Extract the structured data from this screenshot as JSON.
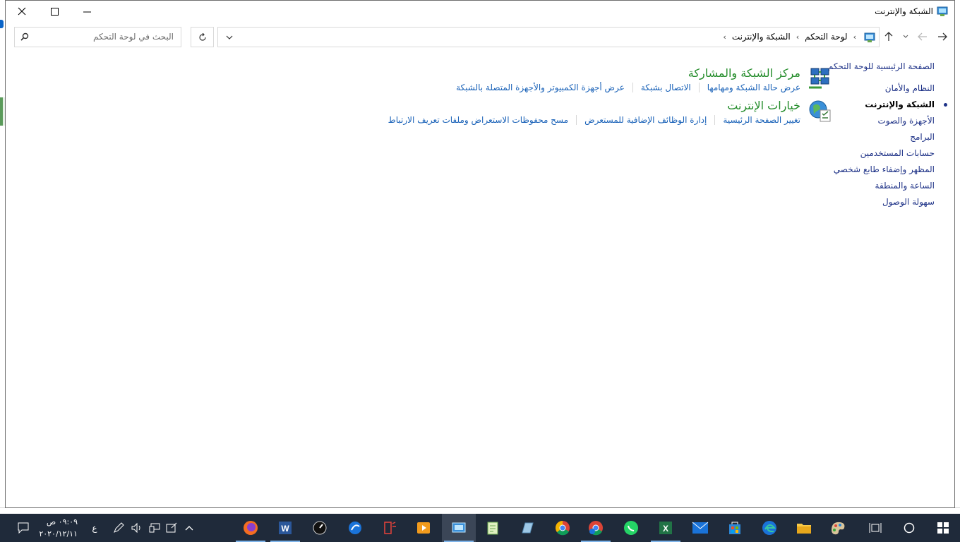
{
  "window": {
    "title": "الشبكة والإنترنت"
  },
  "address_bar": {
    "crumbs": [
      "لوحة التحكم",
      "الشبكة والإنترنت"
    ]
  },
  "search": {
    "placeholder": "البحث في لوحة التحكم"
  },
  "nav": {
    "home": "الصفحة الرئيسية للوحة التحكم",
    "items": [
      {
        "label": "النظام والأمان",
        "current": false
      },
      {
        "label": "الشبكة والإنترنت",
        "current": true
      },
      {
        "label": "الأجهزة والصوت",
        "current": false
      },
      {
        "label": "البرامج",
        "current": false
      },
      {
        "label": "حسابات المستخدمين",
        "current": false
      },
      {
        "label": "المظهر وإضفاء طابع شخصي",
        "current": false
      },
      {
        "label": "الساعة والمنطقة",
        "current": false
      },
      {
        "label": "سهولة الوصول",
        "current": false
      }
    ]
  },
  "categories": [
    {
      "title": "مركز الشبكة والمشاركة",
      "links": [
        "عرض حالة الشبكة ومهامها",
        "الاتصال بشبكة",
        "عرض أجهزة الكمبيوتر والأجهزة المتصلة بالشبكة"
      ]
    },
    {
      "title": "خيارات الإنترنت",
      "links": [
        "تغيير الصفحة الرئيسية",
        "إدارة الوظائف الإضافية للمستعرض",
        "مسح محفوظات الاستعراض وملفات تعريف الارتباط"
      ]
    }
  ],
  "taskbar": {
    "language": "ع",
    "time": "٠٩:٠٩ ص",
    "date": "٢٠٢٠/١٢/١١",
    "pinned": [
      "firefox-icon",
      "word-icon",
      "speedometer-icon",
      "app-blue-icon",
      "phone-icon",
      "media-player-icon",
      "control-panel-icon",
      "notepad-icon",
      "paper-icon",
      "chrome-icon",
      "chrome-alt-icon",
      "whatsapp-icon",
      "excel-icon",
      "mail-icon",
      "store-icon",
      "edge-icon",
      "file-explorer-icon",
      "paint-icon"
    ]
  },
  "colors": {
    "link": "#1a62b8",
    "category_title": "#238c2a",
    "nav_link": "#1e3287",
    "taskbar": "#1f2a3a"
  }
}
